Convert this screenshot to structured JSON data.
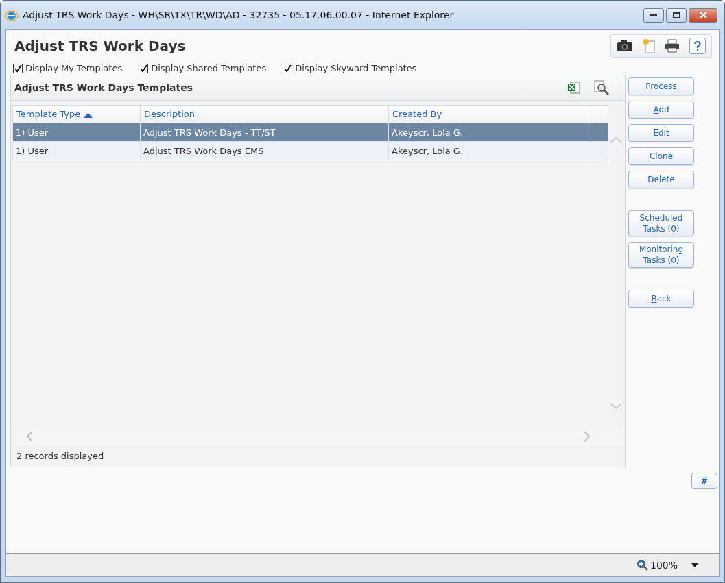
{
  "window": {
    "title": "Adjust TRS Work Days - WH\\SR\\TX\\TR\\WD\\AD - 32735 - 05.17.06.00.07 - Internet Explorer"
  },
  "page_title": "Adjust TRS Work Days",
  "filters": [
    {
      "label": "Display My Templates",
      "checked": true
    },
    {
      "label": "Display Shared Templates",
      "checked": true
    },
    {
      "label": "Display Skyward Templates",
      "checked": true
    }
  ],
  "panel": {
    "title": "Adjust TRS Work Days Templates"
  },
  "table": {
    "columns": [
      {
        "label": "Template Type",
        "sorted": true
      },
      {
        "label": "Description",
        "sorted": false
      },
      {
        "label": "Created By",
        "sorted": false
      }
    ],
    "rows": [
      {
        "cells": [
          "1) User",
          "Adjust TRS Work Days - TT/ST",
          "Akeyscr, Lola G."
        ],
        "selected": true
      },
      {
        "cells": [
          "1) User",
          "Adjust TRS Work Days EMS",
          "Akeyscr, Lola G."
        ],
        "selected": false
      }
    ],
    "footer": "2 records displayed"
  },
  "button_groups": [
    [
      {
        "label": "Process",
        "underline_first": true
      },
      {
        "label": "Add",
        "underline_first": true
      },
      {
        "label": "Edit",
        "underline_first": false
      },
      {
        "label": "Clone",
        "underline_first": true
      },
      {
        "label": "Delete",
        "underline_first": false
      }
    ],
    [
      {
        "label": "Scheduled Tasks (0)",
        "underline_first": false
      },
      {
        "label": "Monitoring Tasks (0)",
        "underline_first": false
      }
    ],
    [
      {
        "label": "Back",
        "underline_first": true
      }
    ]
  ],
  "hash_button": "#",
  "status_bar": {
    "zoom": "100%"
  }
}
